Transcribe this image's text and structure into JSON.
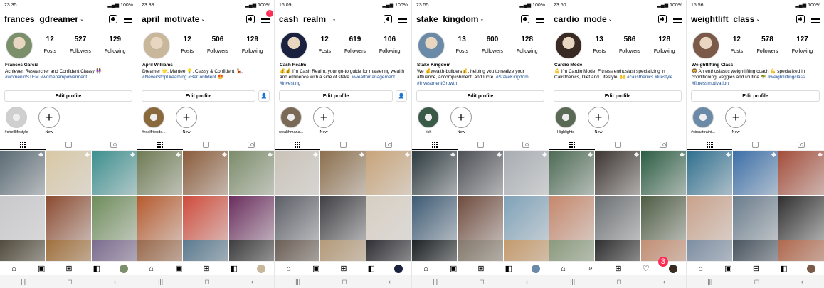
{
  "profiles": [
    {
      "time": "23:35",
      "battery": "100%",
      "username": "frances_gdreamer",
      "posts": "12",
      "followers": "527",
      "following": "129",
      "name": "Frances Garcia",
      "bio": "Achiever, Researcher and Confident Classy 👩🏽‍🤝‍👩🏾",
      "tags": "#womeninSTEM #womenempowerment",
      "stories": [
        {
          "label": "#chefllifestyle"
        }
      ],
      "show_adduser": false,
      "show_notif": false,
      "nav": [
        "home-icon",
        "reels-icon",
        "create-icon",
        "shop-icon",
        "profile-icon"
      ]
    },
    {
      "time": "23:38",
      "battery": "100%",
      "username": "april_motivate",
      "posts": "12",
      "followers": "506",
      "following": "129",
      "name": "April Williams",
      "bio": "Dreamer 🌟, Mentee 💡, Classy & Confident 💃.",
      "tags": "#NeverStopDreaming #BeConfident 😍",
      "stories": [
        {
          "label": "#realfriends..."
        }
      ],
      "show_adduser": true,
      "show_notif": true,
      "notif_count": "1",
      "nav": [
        "home-icon",
        "reels-icon",
        "create-icon",
        "shop-icon",
        "profile-icon"
      ]
    },
    {
      "time": "16:09",
      "battery": "100%",
      "username": "cash_realm_",
      "posts": "12",
      "followers": "619",
      "following": "106",
      "name": "Cash Realm",
      "bio": "💰💰 I'm Cash Realm, your go-to guide for mastering wealth and eminence with a side of stake.",
      "tags": "#wealthmanagement #investing",
      "stories": [
        {
          "label": "wealthmana..."
        }
      ],
      "show_adduser": true,
      "show_notif": false,
      "nav": [
        "home-icon",
        "reels-icon",
        "create-icon",
        "shop-icon",
        "profile-icon"
      ]
    },
    {
      "time": "23:55",
      "battery": "100%",
      "username": "stake_kingdom",
      "posts": "13",
      "followers": "600",
      "following": "128",
      "name": "Stake Kingdom",
      "bio": "We 💰wealth-builders💰, helping you to realize your affluence, accomplishment, and lucre.",
      "tags": "#StakeKingdom #InvestmentGrowth",
      "stories": [
        {
          "label": "rich"
        }
      ],
      "show_adduser": false,
      "show_notif": false,
      "nav": [
        "home-icon",
        "reels-icon",
        "create-icon",
        "shop-icon",
        "profile-icon"
      ]
    },
    {
      "time": "23:50",
      "battery": "100%",
      "username": "cardio_mode",
      "posts": "13",
      "followers": "586",
      "following": "128",
      "name": "Cardio Mode",
      "bio": "💪 I'm Cardio Mode: Fitness enthusiast specializing in Calisthenics, Diet and Lifestyle. 🙌",
      "tags": "#calisthenics #lifestyle",
      "stories": [
        {
          "label": "Highlights"
        }
      ],
      "show_adduser": false,
      "show_notif": false,
      "heart_count": "3",
      "nav": [
        "home-icon",
        "search-icon",
        "create-icon",
        "heart-icon",
        "profile-icon"
      ]
    },
    {
      "time": "15:56",
      "battery": "100%",
      "username": "weightlift_class",
      "posts": "12",
      "followers": "578",
      "following": "127",
      "name": "Weightlifting Class",
      "bio": "🦁 An enthusiastic weightlifting coach 💪 specialized in conditioning, veggies and routine 🥗",
      "tags": "#weightliftingclass #fitnessmotivation",
      "stories": [
        {
          "label": "#circuittraini..."
        }
      ],
      "show_adduser": false,
      "show_notif": false,
      "nav": [
        "home-icon",
        "reels-icon",
        "create-icon",
        "shop-icon",
        "profile-icon"
      ]
    }
  ],
  "labels": {
    "posts": "Posts",
    "followers": "Followers",
    "following": "Following",
    "edit_profile": "Edit profile",
    "new_story": "New"
  }
}
